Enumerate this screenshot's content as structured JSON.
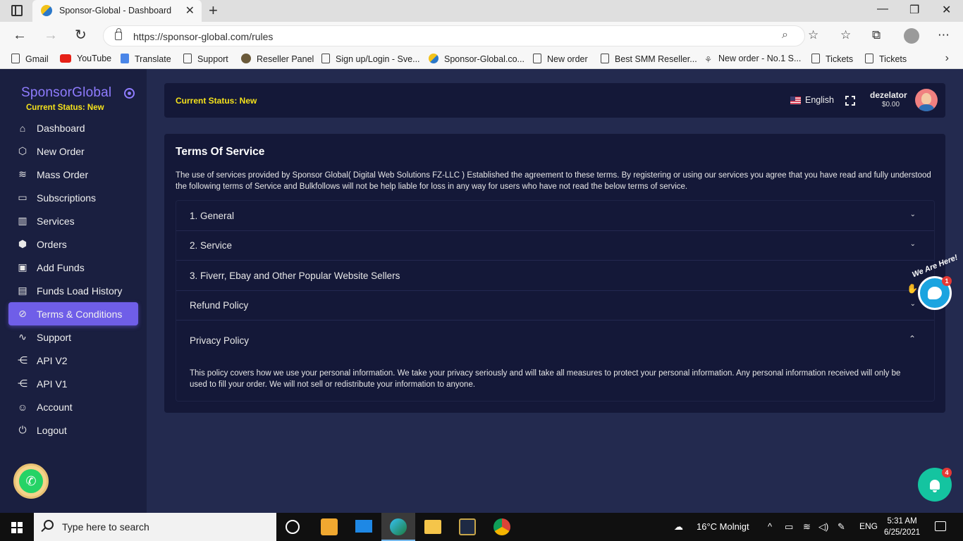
{
  "browser": {
    "tab_title": "Sponsor-Global - Dashboard",
    "url": "https://sponsor-global.com/rules",
    "bookmarks": [
      "Gmail",
      "YouTube",
      "Translate",
      "Support",
      "Reseller Panel",
      "Sign up/Login - Sve...",
      "Sponsor-Global.co...",
      "New order",
      "Best SMM Reseller...",
      "New order - No.1 S...",
      "Tickets",
      "Tickets"
    ]
  },
  "sidebar": {
    "brand": "SponsorGlobal",
    "status": "Current Status: New",
    "items": [
      {
        "label": "Dashboard",
        "icon": "home-icon"
      },
      {
        "label": "New Order",
        "icon": "box-icon"
      },
      {
        "label": "Mass Order",
        "icon": "layers-icon"
      },
      {
        "label": "Subscriptions",
        "icon": "tv-icon"
      },
      {
        "label": "Services",
        "icon": "bar-chart-icon"
      },
      {
        "label": "Orders",
        "icon": "boxes-icon"
      },
      {
        "label": "Add Funds",
        "icon": "money-icon"
      },
      {
        "label": "Funds Load History",
        "icon": "document-icon"
      },
      {
        "label": "Terms & Conditions",
        "icon": "ban-icon"
      },
      {
        "label": "Support",
        "icon": "activity-icon"
      },
      {
        "label": "API V2",
        "icon": "share-icon"
      },
      {
        "label": "API V1",
        "icon": "share-icon"
      },
      {
        "label": "Account",
        "icon": "user-icon"
      },
      {
        "label": "Logout",
        "icon": "power-icon"
      }
    ]
  },
  "header": {
    "status": "Current Status: New",
    "language": "English",
    "username": "dezelator",
    "balance": "$0.00"
  },
  "terms": {
    "title": "Terms Of Service",
    "intro": "The use of services provided by Sponsor Global( Digital Web Solutions FZ-LLC ) Established the agreement to these terms. By registering or using our services you agree that you have read and fully understood the following terms of Service and Bulkfollows will not be help liable for loss in any way for users who have not read the below terms of service.",
    "sections": [
      {
        "label": "1. General",
        "expanded": false
      },
      {
        "label": "2. Service",
        "expanded": false
      },
      {
        "label": "3. Fiverr, Ebay and Other Popular Website Sellers",
        "expanded": false
      },
      {
        "label": "Refund Policy",
        "expanded": false
      },
      {
        "label": "Privacy Policy",
        "expanded": true
      }
    ],
    "privacy_body": "This policy covers how we use your personal information. We take your privacy seriously and will take all measures to protect your personal information. Any personal information received will only be used to fill your order. We will not sell or redistribute your information to anyone."
  },
  "widgets": {
    "chat_tag": "We Are Here!",
    "chat_badge": "1",
    "bell_badge": "4"
  },
  "taskbar": {
    "search_placeholder": "Type here to search",
    "weather": "16°C  Molnigt",
    "lang": "ENG",
    "time": "5:31 AM",
    "date": "6/25/2021"
  },
  "colors": {
    "accent": "#6f5ee8",
    "status_yellow": "#f5e21b",
    "sidebar_bg": "#1a1f40",
    "card_bg": "#141838",
    "page_bg": "#232a4f"
  }
}
